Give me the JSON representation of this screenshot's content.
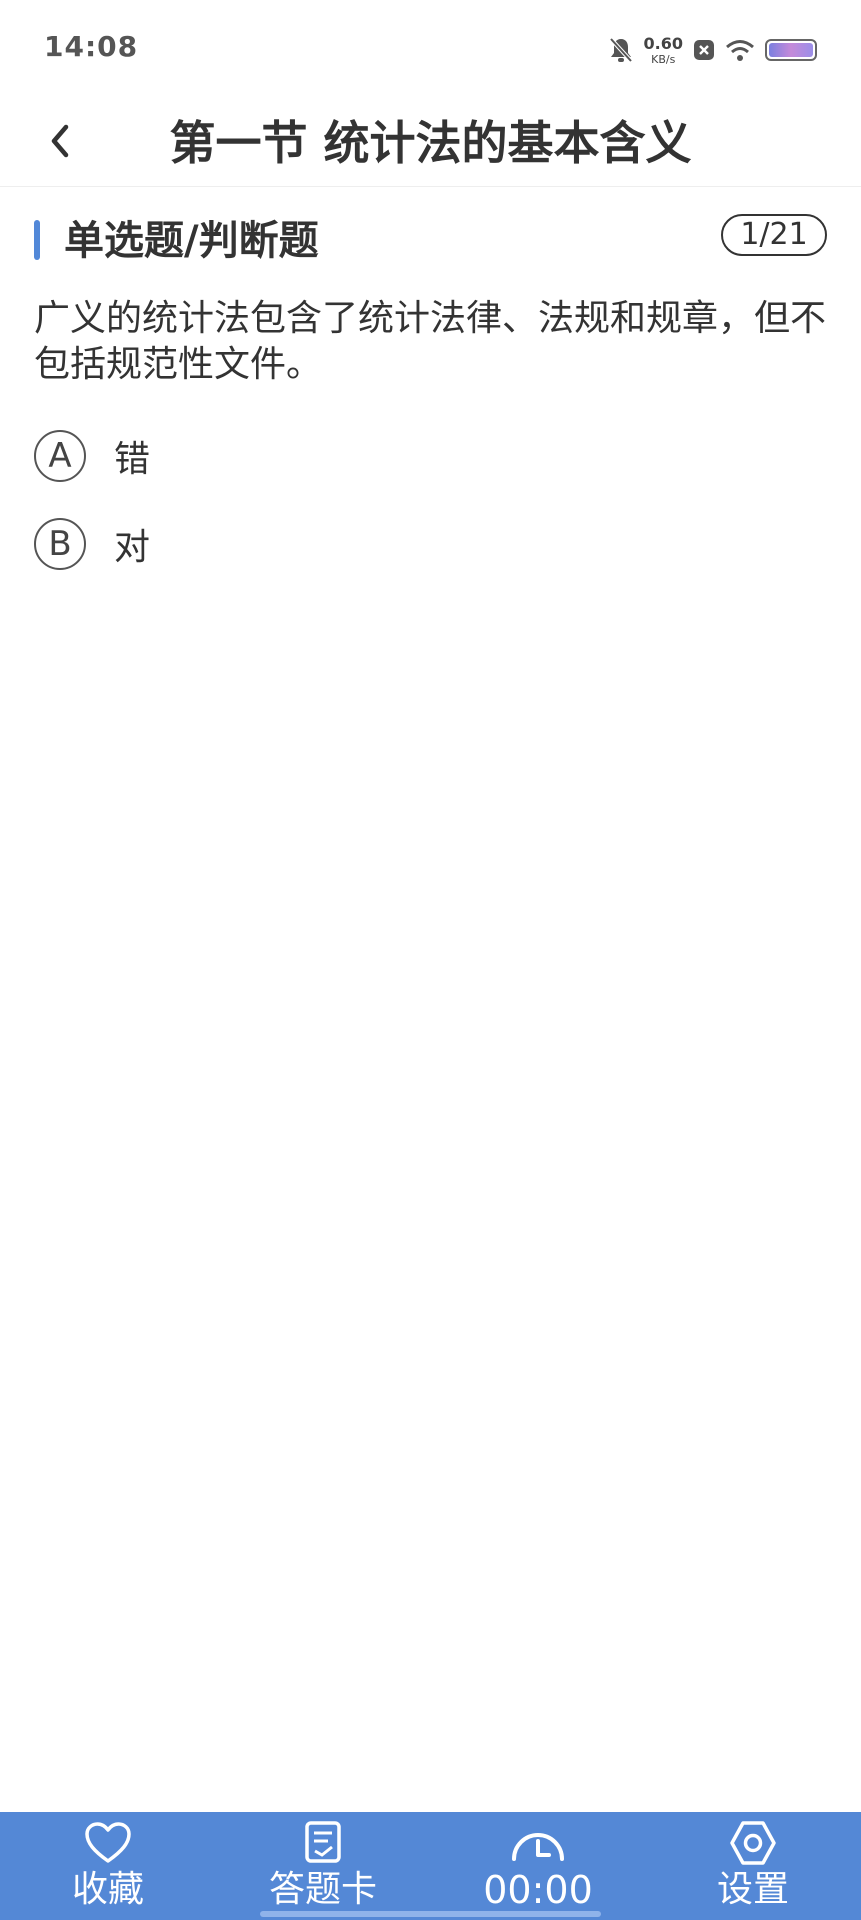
{
  "status_bar": {
    "time": "14:08",
    "net_speed_value": "0.60",
    "net_speed_unit": "KB/s",
    "icons": [
      "bell-off-icon",
      "close-box-icon",
      "wifi-icon",
      "battery-icon"
    ]
  },
  "header": {
    "title": "第一节 统计法的基本含义",
    "back_icon": "chevron-left-icon"
  },
  "question": {
    "type_label": "单选题/判断题",
    "counter": "1/21",
    "text": "广义的统计法包含了统计法律、法规和规章，但不包括规范性文件。",
    "options": [
      {
        "letter": "A",
        "text": "错"
      },
      {
        "letter": "B",
        "text": "对"
      }
    ]
  },
  "bottom_bar": {
    "tabs": [
      {
        "label": "收藏",
        "icon": "heart-icon"
      },
      {
        "label": "答题卡",
        "icon": "answer-sheet-icon"
      },
      {
        "label": "00:00",
        "icon": "timer-icon"
      },
      {
        "label": "设置",
        "icon": "settings-hexagon-icon"
      }
    ]
  },
  "colors": {
    "accent": "#5288d8",
    "bottom_bar": "#5488d6",
    "text": "#333333",
    "background": "#ffffff"
  }
}
